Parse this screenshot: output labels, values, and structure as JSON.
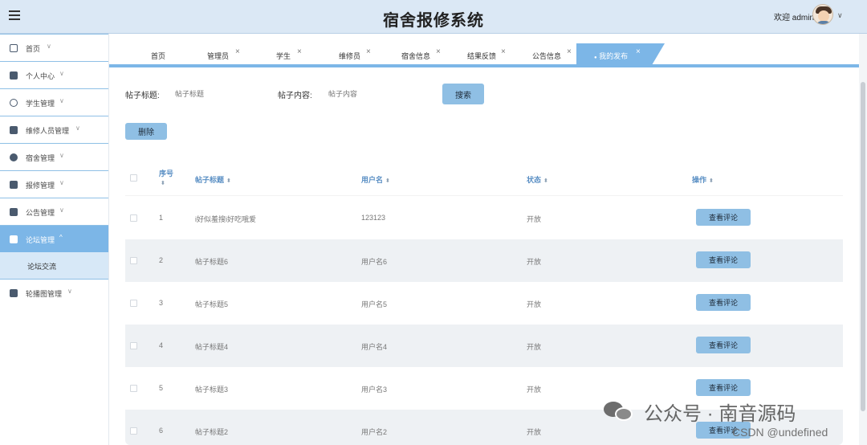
{
  "header": {
    "title": "宿舍报修系统",
    "welcome": "欢迎 admin",
    "caret": "∨"
  },
  "sidebar": {
    "items": [
      {
        "label": "首页",
        "icon": "home-icon"
      },
      {
        "label": "个人中心",
        "icon": "wallet-icon"
      },
      {
        "label": "学生管理",
        "icon": "user-icon"
      },
      {
        "label": "维修人员管理",
        "icon": "ticket-icon"
      },
      {
        "label": "宿舍管理",
        "icon": "check-circle-icon"
      },
      {
        "label": "报修管理",
        "icon": "book-icon"
      },
      {
        "label": "公告管理",
        "icon": "grid-icon"
      },
      {
        "label": "论坛管理",
        "icon": "forum-icon",
        "active": true
      },
      {
        "label": "轮播图管理",
        "icon": "grid-icon"
      }
    ],
    "sub_item": "论坛交流",
    "caret_down": "∨",
    "caret_up": "^"
  },
  "tabs": [
    {
      "label": "首页"
    },
    {
      "label": "管理员"
    },
    {
      "label": "学生"
    },
    {
      "label": "维修员"
    },
    {
      "label": "宿舍信息"
    },
    {
      "label": "结果反馈"
    },
    {
      "label": "公告信息"
    },
    {
      "label": "我的发布",
      "active": true
    }
  ],
  "tab_close": "×",
  "active_dot": "●",
  "search": {
    "title_label": "帖子标题:",
    "title_placeholder": "帖子标题",
    "content_label": "帖子内容:",
    "content_placeholder": "帖子内容",
    "button": "搜索"
  },
  "actions": {
    "delete": "删除"
  },
  "table": {
    "headers": {
      "index": "序号",
      "title": "帖子标题",
      "username": "用户名",
      "status": "状态",
      "action": "操作"
    },
    "sort_glyph": "⬍",
    "rows": [
      {
        "index": "1",
        "title": "i好似羞搜i好吃哦爱",
        "username": "123123",
        "status": "开放",
        "action": "查看评论"
      },
      {
        "index": "2",
        "title": "帖子标题6",
        "username": "用户名6",
        "status": "开放",
        "action": "查看评论"
      },
      {
        "index": "3",
        "title": "帖子标题5",
        "username": "用户名5",
        "status": "开放",
        "action": "查看评论"
      },
      {
        "index": "4",
        "title": "帖子标题4",
        "username": "用户名4",
        "status": "开放",
        "action": "查看评论"
      },
      {
        "index": "5",
        "title": "帖子标题3",
        "username": "用户名3",
        "status": "开放",
        "action": "查看评论"
      },
      {
        "index": "6",
        "title": "帖子标题2",
        "username": "用户名2",
        "status": "开放",
        "action": "查看评论"
      }
    ]
  },
  "watermark": {
    "text": "公众号 · 南音源码",
    "csdn": "CSDN @undefined"
  },
  "colors": {
    "accent": "#7cb6e7",
    "button": "#8fbfe4",
    "header_bg": "#dbe8f5"
  }
}
